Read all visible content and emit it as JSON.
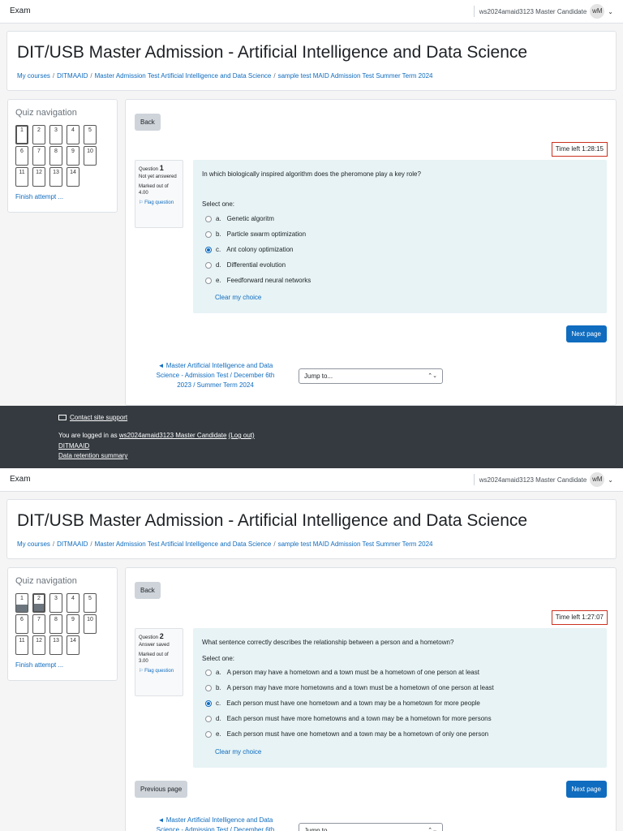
{
  "topbar": {
    "brand": "Exam",
    "user": "ws2024amaid3123 Master Candidate",
    "avatar": "wM",
    "caret": "⌄"
  },
  "header": {
    "title": "DIT/USB Master Admission - Artificial Intelligence and Data Science",
    "breadcrumb": [
      "My courses",
      "DITMAAID",
      "Master Admission Test Artificial Intelligence and Data Science",
      "sample test MAID Admission Test Summer Term 2024"
    ]
  },
  "quiz_nav": {
    "title": "Quiz navigation",
    "finish_label": "Finish attempt ...",
    "questions": [
      "1",
      "2",
      "3",
      "4",
      "5",
      "6",
      "7",
      "8",
      "9",
      "10",
      "11",
      "12",
      "13",
      "14"
    ]
  },
  "buttons": {
    "back": "Back",
    "next": "Next page",
    "previous": "Previous page",
    "clear_choice": "Clear my choice",
    "jump_to": "Jump to...",
    "select_arrows": "⌃⌄"
  },
  "labels": {
    "question": "Question",
    "marked_out_of": "Marked out of",
    "flag": "Flag question",
    "select_one": "Select one:",
    "back_link": "◄ Master Artificial Intelligence and Data Science - Admission Test / December 6th 2023 / Summer Term 2024"
  },
  "screen1": {
    "timer": "Time left 1:28:15",
    "question_number": "1",
    "state": "Not yet answered",
    "marks": "4.00",
    "question_text": "In which biologically inspired algorithm does the pheromone play a key role?",
    "options": [
      {
        "letter": "a.",
        "text": "Genetic algoritm",
        "checked": false
      },
      {
        "letter": "b.",
        "text": "Particle swarm optimization",
        "checked": false
      },
      {
        "letter": "c.",
        "text": "Ant colony optimization",
        "checked": true
      },
      {
        "letter": "d.",
        "text": "Differential evolution",
        "checked": false
      },
      {
        "letter": "e.",
        "text": "Feedforward neural networks",
        "checked": false
      }
    ],
    "current_question": 1,
    "answered_questions": []
  },
  "screen2": {
    "timer": "Time left 1:27:07",
    "question_number": "2",
    "state": "Answer saved",
    "marks": "3.00",
    "question_text": "What sentence correctly describes the relationship between a person and a hometown?",
    "options": [
      {
        "letter": "a.",
        "text": "A person may have a hometown and a town must be a hometown of one person at least",
        "checked": false
      },
      {
        "letter": "b.",
        "text": "A person may have more hometowns and a town must be a hometown of one person at least",
        "checked": false
      },
      {
        "letter": "c.",
        "text": "Each person must have one hometown and a town may be a hometown for more people",
        "checked": true
      },
      {
        "letter": "d.",
        "text": "Each person must have more hometowns and a town may be a hometown for more persons",
        "checked": false
      },
      {
        "letter": "e.",
        "text": "Each person must have one hometown and a town may be a hometown of only one person",
        "checked": false
      }
    ],
    "current_question": 2,
    "answered_questions": [
      1,
      2
    ]
  },
  "footer": {
    "contact": "Contact site support",
    "logged_in_prefix": "You are logged in as ",
    "logged_in_user": "ws2024amaid3123 Master Candidate",
    "logout": "(Log out)",
    "course": "DITMAAID",
    "retention": "Data retention summary"
  }
}
